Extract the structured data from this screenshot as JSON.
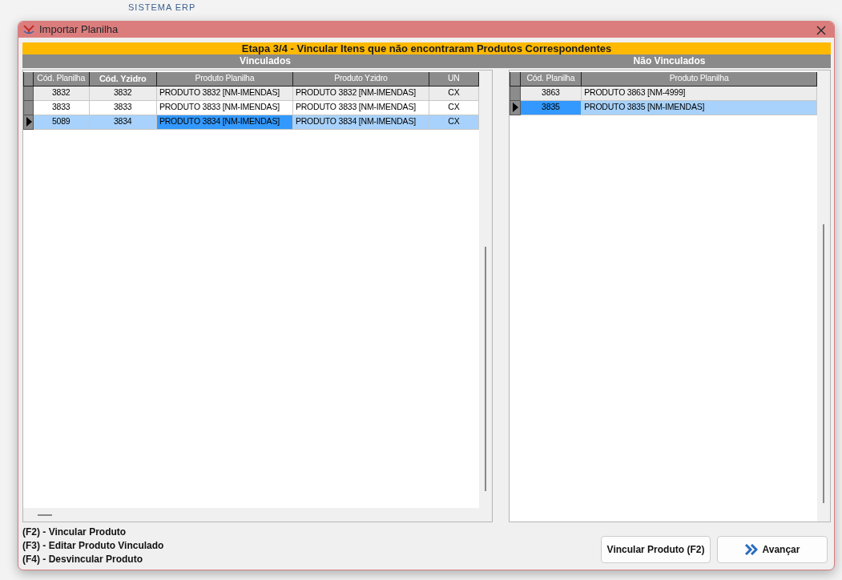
{
  "background": {
    "logo_caption": "SISTEMA ERP"
  },
  "dialog": {
    "title": "Importar Planilha",
    "step_banner": "Etapa 3/4 - Vincular Itens que não encontraram Produtos Correspondentes",
    "panels": [
      {
        "heading": "Vinculados",
        "columns": [
          {
            "label": "Cód. Planilha",
            "bold": false,
            "kind": "code"
          },
          {
            "label": "Cód. Yzidro",
            "bold": true,
            "kind": "code"
          },
          {
            "label": "Produto Planilha",
            "bold": false,
            "kind": "text"
          },
          {
            "label": "Produto Yzidro",
            "bold": false,
            "kind": "text"
          },
          {
            "label": "UN",
            "bold": false,
            "kind": "code"
          }
        ],
        "rows": [
          {
            "selected": false,
            "cells": [
              {
                "text": "3832",
                "focused": false
              },
              {
                "text": "3832",
                "focused": false
              },
              {
                "text": "PRODUTO 3832 [NM-IMENDAS]",
                "focused": false
              },
              {
                "text": "PRODUTO 3832 [NM-IMENDAS]",
                "focused": false
              },
              {
                "text": "CX",
                "focused": false
              }
            ]
          },
          {
            "selected": false,
            "cells": [
              {
                "text": "3833",
                "focused": false
              },
              {
                "text": "3833",
                "focused": false
              },
              {
                "text": "PRODUTO 3833 [NM-IMENDAS]",
                "focused": false
              },
              {
                "text": "PRODUTO 3833 [NM-IMENDAS]",
                "focused": false
              },
              {
                "text": "CX",
                "focused": false
              }
            ]
          },
          {
            "selected": true,
            "cells": [
              {
                "text": "5089",
                "focused": false
              },
              {
                "text": "3834",
                "focused": false
              },
              {
                "text": "PRODUTO 3834 [NM-IMENDAS]",
                "focused": true
              },
              {
                "text": "PRODUTO 3834 [NM-IMENDAS]",
                "focused": false
              },
              {
                "text": "CX",
                "focused": false
              }
            ]
          }
        ]
      },
      {
        "heading": "Não Vinculados",
        "columns": [
          {
            "label": "Cód. Planilha",
            "bold": false,
            "kind": "code"
          },
          {
            "label": "Produto Planilha",
            "bold": false,
            "kind": "text"
          }
        ],
        "rows": [
          {
            "selected": false,
            "cells": [
              {
                "text": "3863",
                "focused": false
              },
              {
                "text": "PRODUTO 3863 [NM-4999]",
                "focused": false
              }
            ]
          },
          {
            "selected": true,
            "cells": [
              {
                "text": "3835",
                "focused": true
              },
              {
                "text": "PRODUTO 3835 [NM-IMENDAS]",
                "focused": false
              }
            ]
          }
        ]
      }
    ],
    "shortcuts": [
      "(F2) - Vincular Produto",
      "(F3) - Editar Produto Vinculado",
      "(F4) - Desvincular Produto"
    ],
    "buttons": [
      {
        "label": "Vincular Produto (F2)",
        "kind": "plain"
      },
      {
        "label": "Avançar",
        "kind": "next"
      }
    ]
  }
}
